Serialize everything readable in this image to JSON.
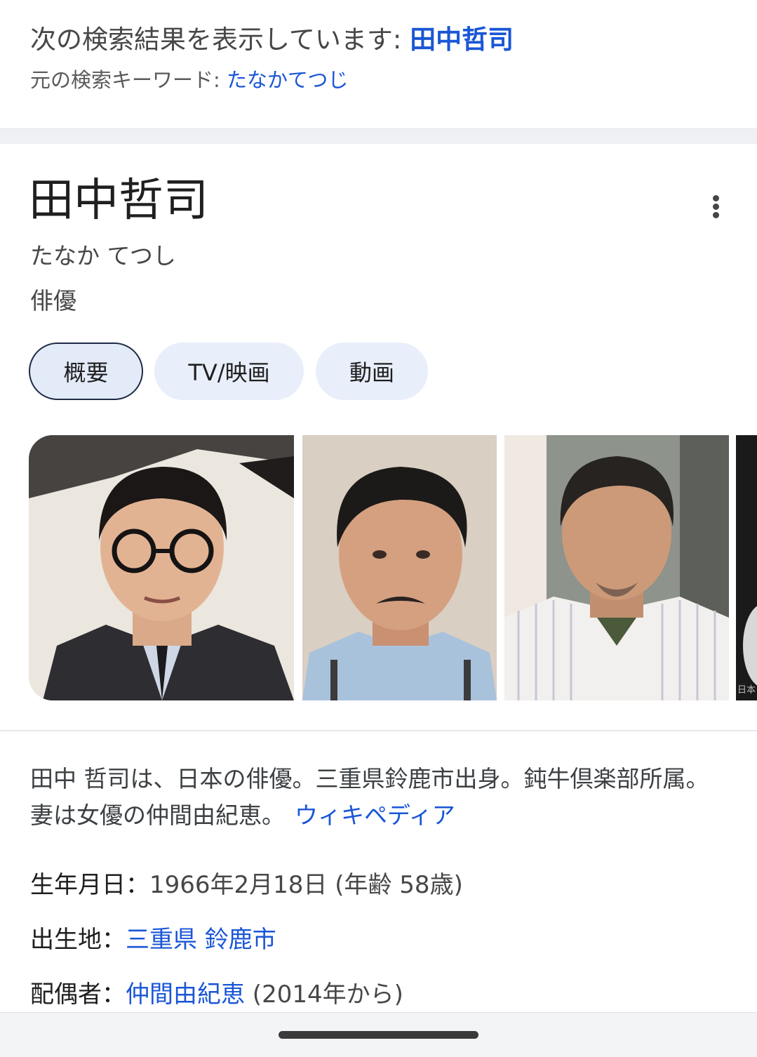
{
  "correction": {
    "showing_prefix": "次の検索結果を表示しています: ",
    "corrected_query": "田中哲司",
    "original_prefix": "元の検索キーワード: ",
    "original_query": "たなかてつじ"
  },
  "panel": {
    "title": "田中哲司",
    "more_icon": "more-vert-icon",
    "reading": "たなか てつし",
    "occupation": "俳優",
    "tabs": [
      {
        "label": "概要",
        "active": true
      },
      {
        "label": "TV/映画",
        "active": false
      },
      {
        "label": "動画",
        "active": false
      }
    ],
    "images": [
      {
        "alt": "actor-photo-glasses"
      },
      {
        "alt": "actor-photo-mustache"
      },
      {
        "alt": "actor-photo-striped-shirt"
      },
      {
        "alt": "actor-photo-partial",
        "caption": "日本"
      }
    ],
    "description": "田中 哲司は、日本の俳優。三重県鈴鹿市出身。鈍牛倶楽部所属。妻は女優の仲間由紀恵。",
    "source_link": "ウィキペディア",
    "facts": {
      "birth": {
        "label": "生年月日：",
        "value": "1966年2月18日 (年齢 58歳)"
      },
      "birthplace": {
        "label": "出生地：",
        "link": "三重県 鈴鹿市"
      },
      "spouse": {
        "label": "配偶者：",
        "link": "仲間由紀恵",
        "value": " (2014年から)"
      }
    }
  },
  "colors": {
    "link": "#1a56d6",
    "chip_bg": "#e8eefa",
    "chip_active_border": "#1f2b45"
  }
}
